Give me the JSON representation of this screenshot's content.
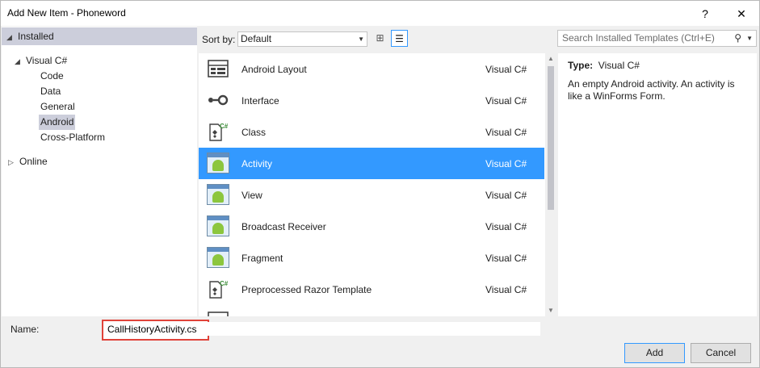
{
  "window": {
    "title": "Add New Item - Phoneword",
    "help": "?",
    "close": "✕"
  },
  "tree": {
    "installed": "Installed",
    "visual_csharp": "Visual C#",
    "children": [
      "Code",
      "Data",
      "General",
      "Android",
      "Cross-Platform"
    ],
    "selected": "Android",
    "online": "Online"
  },
  "toolbar": {
    "sort_label": "Sort by:",
    "sort_value": "Default",
    "search_placeholder": "Search Installed Templates (Ctrl+E)"
  },
  "templates": [
    {
      "name": "Android Layout",
      "language": "Visual C#",
      "icon": "layout-icon"
    },
    {
      "name": "Interface",
      "language": "Visual C#",
      "icon": "interface-icon"
    },
    {
      "name": "Class",
      "language": "Visual C#",
      "icon": "class-icon"
    },
    {
      "name": "Activity",
      "language": "Visual C#",
      "icon": "android-icon",
      "selected": true
    },
    {
      "name": "View",
      "language": "Visual C#",
      "icon": "android-icon"
    },
    {
      "name": "Broadcast Receiver",
      "language": "Visual C#",
      "icon": "android-icon"
    },
    {
      "name": "Fragment",
      "language": "Visual C#",
      "icon": "android-icon"
    },
    {
      "name": "Preprocessed Razor Template",
      "language": "Visual C#",
      "icon": "class-icon"
    }
  ],
  "description": {
    "type_label": "Type:",
    "type_value": "Visual C#",
    "text": "An empty Android activity.  An activity is like a WinForms Form."
  },
  "form": {
    "name_label": "Name:",
    "name_value": "CallHistoryActivity.cs",
    "add_label": "Add",
    "cancel_label": "Cancel"
  },
  "colors": {
    "selection": "#3399ff",
    "tree_selection": "#cccedb",
    "highlight_border": "#e0433a"
  }
}
